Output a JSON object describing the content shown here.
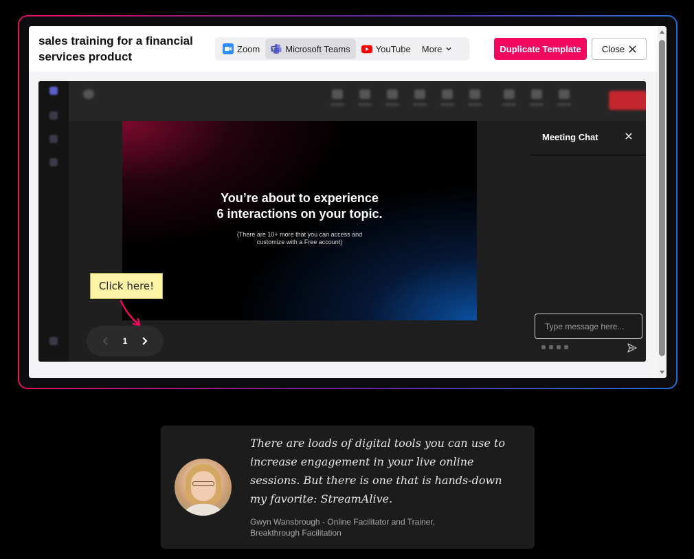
{
  "modal": {
    "title": "sales training for a financial services product",
    "platform_tabs": [
      {
        "label": "Zoom",
        "icon": "zoom-icon",
        "color": "#2d8cff",
        "active": false
      },
      {
        "label": "Microsoft Teams",
        "icon": "teams-icon",
        "color": "#5b5fc7",
        "active": true
      },
      {
        "label": "YouTube",
        "icon": "youtube-icon",
        "color": "#ff0000",
        "active": false
      },
      {
        "label": "More",
        "icon": "chevron-down-icon",
        "active": false
      }
    ],
    "duplicate_label": "Duplicate Template",
    "close_label": "Close",
    "accent_color": "#f2075e"
  },
  "slide": {
    "heading_line1": "You’re about to experience",
    "heading_line2": "6 interactions on your topic.",
    "sub_line1": "(There are 10+ more that you can access and",
    "sub_line2": "customize with a Free account)"
  },
  "pager": {
    "page": "1"
  },
  "callout": {
    "text": "Click here!"
  },
  "chat": {
    "title": "Meeting Chat",
    "input_placeholder": "Type message here..."
  },
  "testimonial": {
    "quote": "There are loads of digital tools you can use to increase engagement in your live online sessions. But there is one that is hands-down my favorite: StreamAlive.",
    "author_line1": "Gwyn Wansbrough - Online Facilitator and Trainer,",
    "author_line2": "Breakthrough Facilitation"
  }
}
